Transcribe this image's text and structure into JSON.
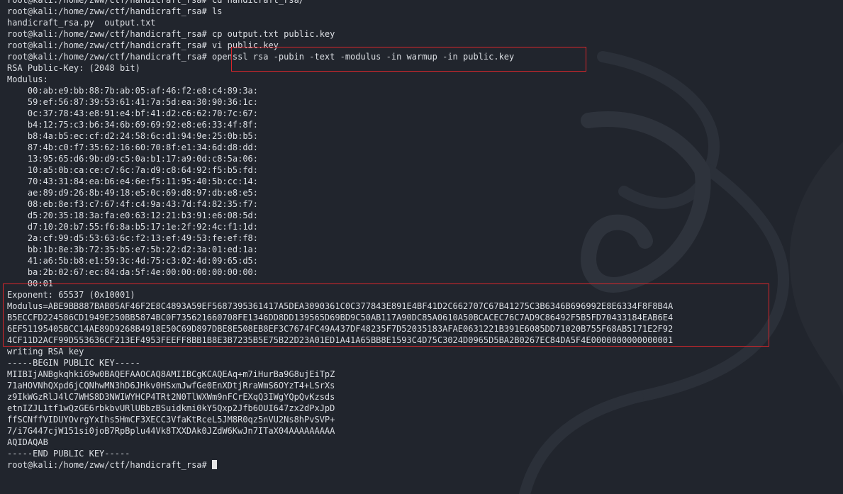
{
  "terminal": {
    "lines": [
      "root@kali:/home/zww/ctf/handicraft_rsa# cd handicraft_rsa/",
      "root@kali:/home/zww/ctf/handicraft_rsa# ls",
      "handicraft_rsa.py  output.txt",
      "root@kali:/home/zww/ctf/handicraft_rsa# cp output.txt public.key",
      "root@kali:/home/zww/ctf/handicraft_rsa# vi public.key",
      "root@kali:/home/zww/ctf/handicraft_rsa# openssl rsa -pubin -text -modulus -in warmup -in public.key",
      "RSA Public-Key: (2048 bit)",
      "Modulus:",
      "    00:ab:e9:bb:88:7b:ab:05:af:46:f2:e8:c4:89:3a:",
      "    59:ef:56:87:39:53:61:41:7a:5d:ea:30:90:36:1c:",
      "    0c:37:78:43:e8:91:e4:bf:41:d2:c6:62:70:7c:67:",
      "    b4:12:75:c3:b6:34:6b:69:69:92:e8:e6:33:4f:8f:",
      "    b8:4a:b5:ec:cf:d2:24:58:6c:d1:94:9e:25:0b:b5:",
      "    87:4b:c0:f7:35:62:16:60:70:8f:e1:34:6d:d8:dd:",
      "    13:95:65:d6:9b:d9:c5:0a:b1:17:a9:0d:c8:5a:06:",
      "    10:a5:0b:ca:ce:c7:6c:7a:d9:c8:64:92:f5:b5:fd:",
      "    70:43:31:84:ea:b6:e4:6e:f5:11:95:40:5b:cc:14:",
      "    ae:89:d9:26:8b:49:18:e5:0c:69:d8:97:db:e8:e5:",
      "    08:eb:8e:f3:c7:67:4f:c4:9a:43:7d:f4:82:35:f7:",
      "    d5:20:35:18:3a:fa:e0:63:12:21:b3:91:e6:08:5d:",
      "    d7:10:20:b7:55:f6:8a:b5:17:1e:2f:92:4c:f1:1d:",
      "    2a:cf:99:d5:53:63:6c:f2:13:ef:49:53:fe:ef:f8:",
      "    bb:1b:8e:3b:72:35:b5:e7:5b:22:d2:3a:01:ed:1a:",
      "    41:a6:5b:b8:e1:59:3c:4d:75:c3:02:4d:09:65:d5:",
      "    ba:2b:02:67:ec:84:da:5f:4e:00:00:00:00:00:00:",
      "    00:01",
      "Exponent: 65537 (0x10001)",
      "Modulus=ABE9BB887BAB05AF46F2E8C4893A59EF5687395361417A5DEA3090361C0C377843E891E4BF41D2C662707C67B41275C3B6346B696992E8E6334F8F8B4A",
      "B5ECCFD224586CD1949E250BB5874BC0F735621660708FE1346DD8DD139565D69BD9C50AB117A90DC85A0610A50BCACEC76C7AD9C86492F5B5FD70433184EAB6E4",
      "6EF51195405BCC14AE89D9268B4918E50C69D897DBE8E508EB8EF3C7674FC49A437DF48235F7D52035183AFAE0631221B391E6085DD71020B755F68AB5171E2F92",
      "4CF11D2ACF99D553636CF213EF4953FEEFF8BB1B8E3B7235B5E75B22D23A01ED1A41A65BB8E1593C4D75C3024D0965D5BA2B0267EC84DA5F4E0000000000000001",
      "writing RSA key",
      "-----BEGIN PUBLIC KEY-----",
      "MIIBIjANBgkqhkiG9w0BAQEFAAOCAQ8AMIIBCgKCAQEAq+m7iHurBa9G8ujEiTpZ",
      "71aHOVNhQXpd6jCQNhwMN3hD6JHkv0HSxmJwfGe0EnXDtjRraWmS6OYzT4+LSrXs",
      "z9IkWGzRlJ4lC7WHS8D3NWIWYHCP4TRt2N0TlWXWm9nFCrEXqQ3IWgYQpQvKzsds",
      "etnIZJL1tf1wQzGE6rbkbvURlUBbzBSuidkmi0kY5Qxp2Jfb6OUI647zx2dPxJpD",
      "ffSCNffVIDUYOvrgYxIhs5HmCF3XECC3VfaKtRceL5JM8R0qz5nVU2Ns8hPvSVP+",
      "7/i7G447cjW151si0joB7RpBplu44Vk8TXXDAk0JZdW6KwJn7ITaX04AAAAAAAAA",
      "AQIDAQAB",
      "-----END PUBLIC KEY-----",
      "root@kali:/home/zww/ctf/handicraft_rsa# "
    ]
  }
}
